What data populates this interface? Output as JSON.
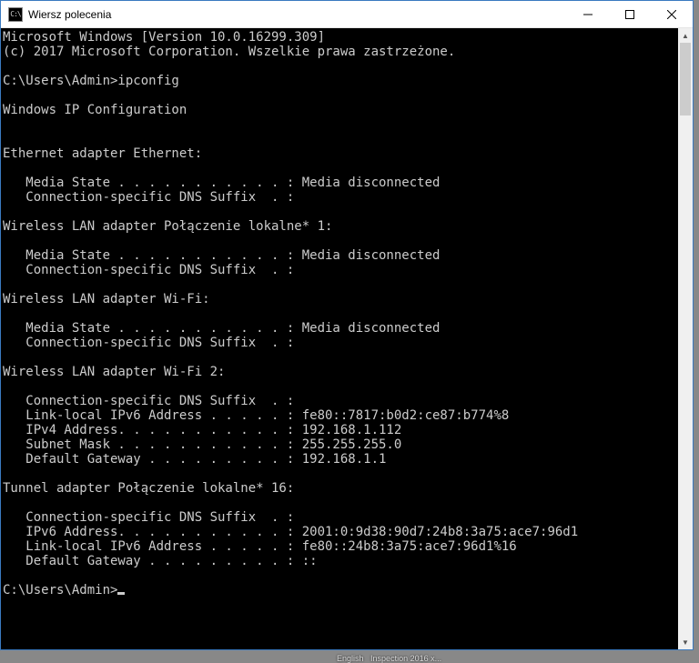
{
  "window": {
    "title": "Wiersz polecenia",
    "icon_text": "C:\\"
  },
  "console": {
    "lines": [
      "Microsoft Windows [Version 10.0.16299.309]",
      "(c) 2017 Microsoft Corporation. Wszelkie prawa zastrzeżone.",
      "",
      "C:\\Users\\Admin>ipconfig",
      "",
      "Windows IP Configuration",
      "",
      "",
      "Ethernet adapter Ethernet:",
      "",
      "   Media State . . . . . . . . . . . : Media disconnected",
      "   Connection-specific DNS Suffix  . :",
      "",
      "Wireless LAN adapter Połączenie lokalne* 1:",
      "",
      "   Media State . . . . . . . . . . . : Media disconnected",
      "   Connection-specific DNS Suffix  . :",
      "",
      "Wireless LAN adapter Wi-Fi:",
      "",
      "   Media State . . . . . . . . . . . : Media disconnected",
      "   Connection-specific DNS Suffix  . :",
      "",
      "Wireless LAN adapter Wi-Fi 2:",
      "",
      "   Connection-specific DNS Suffix  . :",
      "   Link-local IPv6 Address . . . . . : fe80::7817:b0d2:ce87:b774%8",
      "   IPv4 Address. . . . . . . . . . . : 192.168.1.112",
      "   Subnet Mask . . . . . . . . . . . : 255.255.255.0",
      "   Default Gateway . . . . . . . . . : 192.168.1.1",
      "",
      "Tunnel adapter Połączenie lokalne* 16:",
      "",
      "   Connection-specific DNS Suffix  . :",
      "   IPv6 Address. . . . . . . . . . . : 2001:0:9d38:90d7:24b8:3a75:ace7:96d1",
      "   Link-local IPv6 Address . . . . . : fe80::24b8:3a75:ace7:96d1%16",
      "   Default Gateway . . . . . . . . . : ::",
      "",
      "C:\\Users\\Admin>"
    ]
  },
  "taskbar": {
    "hint1": "English",
    "hint2": "Inspection 2016 x..."
  }
}
